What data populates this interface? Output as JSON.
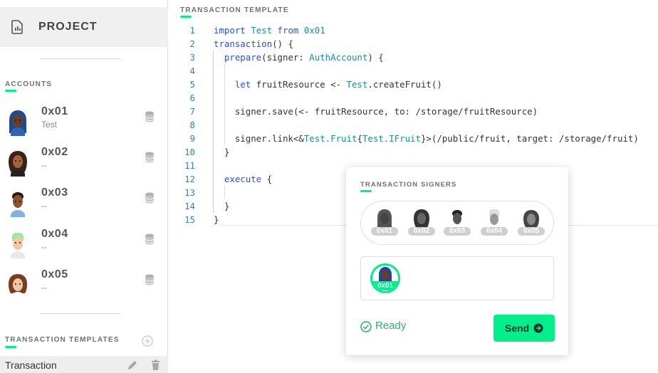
{
  "sidebar": {
    "project_title": "PROJECT",
    "accounts_label": "ACCOUNTS",
    "accounts": [
      {
        "address": "0x01",
        "name": "Test"
      },
      {
        "address": "0x02",
        "name": "--"
      },
      {
        "address": "0x03",
        "name": "--"
      },
      {
        "address": "0x04",
        "name": "--"
      },
      {
        "address": "0x05",
        "name": "--"
      }
    ],
    "templates_label": "TRANSACTION TEMPLATES",
    "templates": [
      {
        "label": "Transaction"
      }
    ]
  },
  "editor": {
    "label": "TRANSACTION TEMPLATE",
    "line_numbers": [
      "1",
      "2",
      "3",
      "4",
      "5",
      "6",
      "7",
      "8",
      "9",
      "10",
      "11",
      "12",
      "13",
      "14",
      "15"
    ]
  },
  "signers_panel": {
    "label": "TRANSACTION SIGNERS",
    "signers": [
      "0x01",
      "0x02",
      "0x03",
      "0x04",
      "0x05"
    ],
    "selected": [
      "0x01"
    ],
    "status": "Ready",
    "send_label": "Send"
  },
  "colors": {
    "accent": "#00ef8b",
    "keyword": "#2a4fe0",
    "type": "#1d8f8f",
    "line_number": "#2f7fbf"
  }
}
